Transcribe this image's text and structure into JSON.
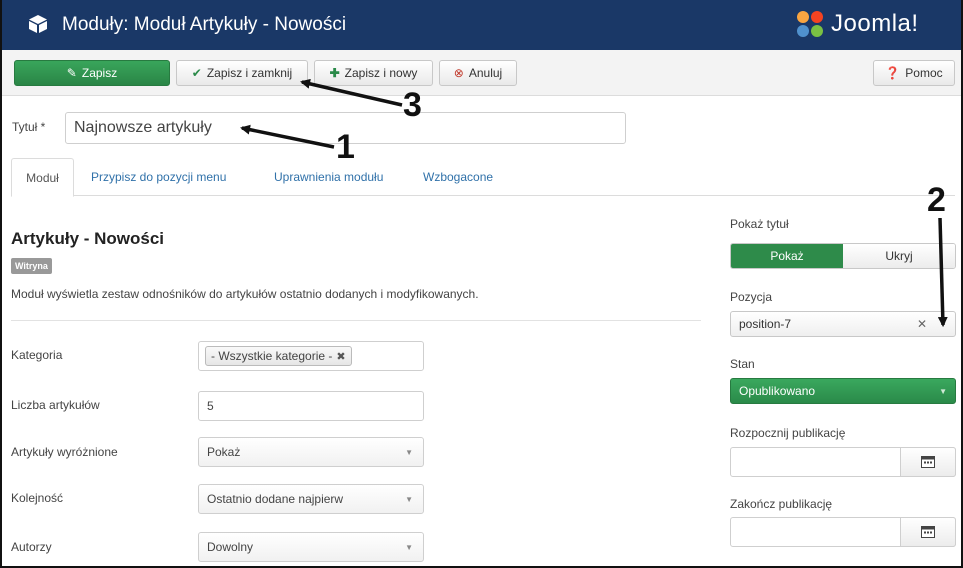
{
  "header": {
    "title": "Moduły: Moduł Artykuły - Nowości",
    "logo_text": "Joomla!",
    "bg_color": "#1a3867"
  },
  "toolbar": {
    "save_label": "Zapisz",
    "save_close_label": "Zapisz i zamknij",
    "save_new_label": "Zapisz i nowy",
    "cancel_label": "Anuluj",
    "help_label": "Pomoc",
    "save_color": "#2e8b4a"
  },
  "title_field": {
    "label": "Tytuł *",
    "value": "Najnowsze artykuły"
  },
  "tabs": [
    {
      "label": "Moduł",
      "active": true
    },
    {
      "label": "Przypisz do pozycji menu",
      "active": false
    },
    {
      "label": "Uprawnienia modułu",
      "active": false
    },
    {
      "label": "Wzbogacone",
      "active": false
    }
  ],
  "module": {
    "name": "Artykuły - Nowości",
    "badge": "Witryna",
    "description": "Moduł wyświetla zestaw odnośników do artykułów ostatnio dodanych i modyfikowanych."
  },
  "fields": {
    "category": {
      "label": "Kategoria",
      "chip": "- Wszystkie kategorie -"
    },
    "count": {
      "label": "Liczba artykułów",
      "value": "5"
    },
    "featured": {
      "label": "Artykuły wyróżnione",
      "value": "Pokaż"
    },
    "ordering": {
      "label": "Kolejność",
      "value": "Ostatnio dodane najpierw"
    },
    "authors": {
      "label": "Autorzy",
      "value": "Dowolny"
    }
  },
  "right": {
    "show_title_label": "Pokaż tytuł",
    "show_on": "Pokaż",
    "show_off": "Ukryj",
    "position_label": "Pozycja",
    "position_value": "position-7",
    "state_label": "Stan",
    "state_value": "Opublikowano",
    "publish_up_label": "Rozpocznij publikację",
    "publish_down_label": "Zakończ publikację",
    "state_color": "#2e8b4a"
  },
  "annotations": {
    "n1": "1",
    "n2": "2",
    "n3": "3"
  }
}
